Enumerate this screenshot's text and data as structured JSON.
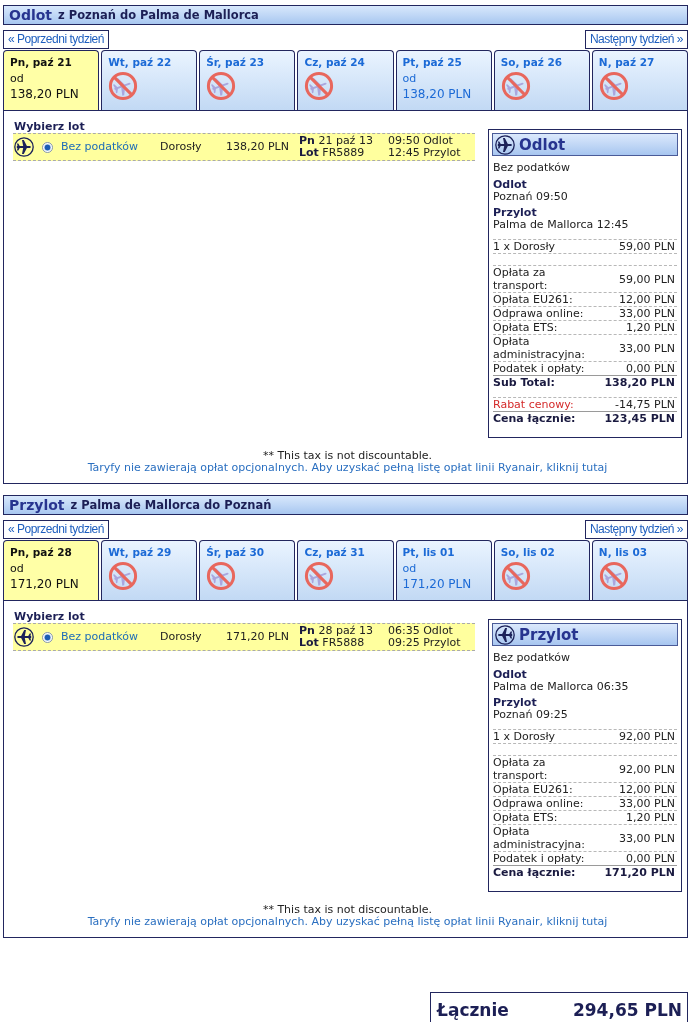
{
  "journeys": [
    {
      "kind": "outbound",
      "title": "Odlot",
      "route": "z Poznań do Palma de Mallorca",
      "prev_week": "« Poprzedni tydzień",
      "next_week": "Następny tydzień »",
      "days": [
        {
          "label": "Pn, paź 21",
          "selected": true,
          "available": true,
          "from": "od",
          "price": "138,20 PLN"
        },
        {
          "label": "Wt, paź 22",
          "selected": false,
          "available": false
        },
        {
          "label": "Śr, paź 23",
          "selected": false,
          "available": false
        },
        {
          "label": "Cz, paź 24",
          "selected": false,
          "available": false
        },
        {
          "label": "Pt, paź 25",
          "selected": false,
          "available": true,
          "from": "od",
          "price": "138,20 PLN"
        },
        {
          "label": "So, paź 26",
          "selected": false,
          "available": false
        },
        {
          "label": "N, paź 27",
          "selected": false,
          "available": false
        }
      ],
      "choose_label": "Wybierz lot",
      "flights": [
        {
          "selected": true,
          "fare": "Bez podatków",
          "passenger": "Dorosły",
          "price": "138,20 PLN",
          "date": "**Pn** 21 paź 13",
          "flight": "**Lot** FR5889",
          "departure": "09:50 Odlot",
          "arrival": "12:45 Przylot"
        }
      ],
      "summary": {
        "title": "Odlot",
        "fare": "Bez podatków",
        "departure_label": "Odlot",
        "departure": "Poznań 09:50",
        "arrival_label": "Przylot",
        "arrival": "Palma de Mallorca 12:45",
        "lines": [
          {
            "kind": "passenger",
            "label": "1 x Dorosły",
            "amount": "59,00 PLN"
          },
          {
            "kind": "fee",
            "label": "Opłata za transport:",
            "amount": "59,00 PLN"
          },
          {
            "kind": "fee",
            "label": "Opłata EU261:",
            "amount": "12,00 PLN"
          },
          {
            "kind": "fee",
            "label": "Odprawa online:",
            "amount": "33,00 PLN"
          },
          {
            "kind": "fee",
            "label": "Opłata ETS:",
            "amount": "1,20 PLN"
          },
          {
            "kind": "fee",
            "label": "Opłata administracyjna:",
            "amount": "33,00 PLN"
          },
          {
            "kind": "fee",
            "label": "Podatek i opłaty:",
            "amount": "0,00 PLN"
          },
          {
            "kind": "subtotal",
            "label": "Sub Total:",
            "amount": "138,20 PLN"
          },
          {
            "kind": "discount",
            "label": "Rabat cenowy:",
            "amount": "-14,75 PLN"
          },
          {
            "kind": "total",
            "label": "Cena łącznie:",
            "amount": "123,45 PLN"
          }
        ]
      },
      "note": "** This tax is not discountable.",
      "fees_link": "Taryfy nie zawierają opłat opcjonalnych. Aby uzyskać pełną listę opłat linii Ryanair, kliknij tutaj"
    },
    {
      "kind": "inbound",
      "title": "Przylot",
      "route": "z Palma de Mallorca do Poznań",
      "prev_week": "« Poprzedni tydzień",
      "next_week": "Następny tydzień »",
      "days": [
        {
          "label": "Pn, paź 28",
          "selected": true,
          "available": true,
          "from": "od",
          "price": "171,20 PLN"
        },
        {
          "label": "Wt, paź 29",
          "selected": false,
          "available": false
        },
        {
          "label": "Śr, paź 30",
          "selected": false,
          "available": false
        },
        {
          "label": "Cz, paź 31",
          "selected": false,
          "available": false
        },
        {
          "label": "Pt, lis 01",
          "selected": false,
          "available": true,
          "from": "od",
          "price": "171,20 PLN"
        },
        {
          "label": "So, lis 02",
          "selected": false,
          "available": false
        },
        {
          "label": "N, lis 03",
          "selected": false,
          "available": false
        }
      ],
      "choose_label": "Wybierz lot",
      "flights": [
        {
          "selected": true,
          "fare": "Bez podatków",
          "passenger": "Dorosły",
          "price": "171,20 PLN",
          "date": "**Pn** 28 paź 13",
          "flight": "**Lot** FR5888",
          "departure": "06:35 Odlot",
          "arrival": "09:25 Przylot"
        }
      ],
      "summary": {
        "title": "Przylot",
        "fare": "Bez podatków",
        "departure_label": "Odlot",
        "departure": "Palma de Mallorca 06:35",
        "arrival_label": "Przylot",
        "arrival": "Poznań 09:25",
        "lines": [
          {
            "kind": "passenger",
            "label": "1 x Dorosły",
            "amount": "92,00 PLN"
          },
          {
            "kind": "fee",
            "label": "Opłata za transport:",
            "amount": "92,00 PLN"
          },
          {
            "kind": "fee",
            "label": "Opłata EU261:",
            "amount": "12,00 PLN"
          },
          {
            "kind": "fee",
            "label": "Odprawa online:",
            "amount": "33,00 PLN"
          },
          {
            "kind": "fee",
            "label": "Opłata ETS:",
            "amount": "1,20 PLN"
          },
          {
            "kind": "fee",
            "label": "Opłata administracyjna:",
            "amount": "33,00 PLN"
          },
          {
            "kind": "fee",
            "label": "Podatek i opłaty:",
            "amount": "0,00 PLN"
          },
          {
            "kind": "total",
            "label": "Cena łącznie:",
            "amount": "171,20 PLN"
          }
        ]
      },
      "note": "** This tax is not discountable.",
      "fees_link": "Taryfy nie zawierają opłat opcjonalnych. Aby uzyskać pełną listę opłat linii Ryanair, kliknij tutaj"
    }
  ],
  "total": {
    "label": "Łącznie",
    "amount": "294,65 PLN"
  }
}
